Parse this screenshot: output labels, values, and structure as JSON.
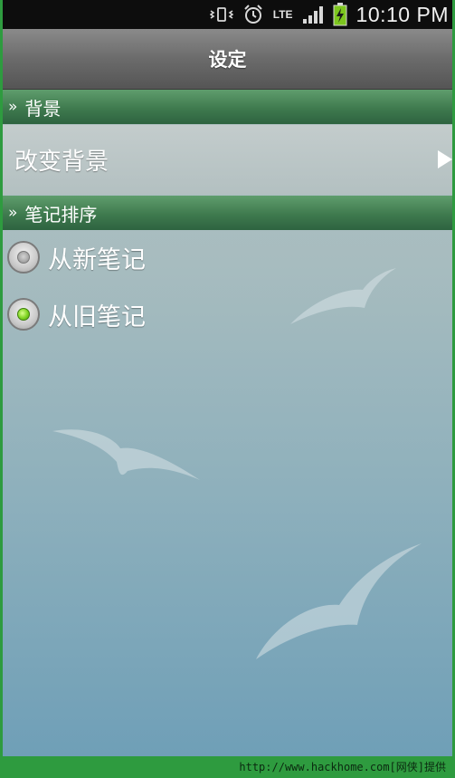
{
  "status_bar": {
    "icons": [
      "vibrate-icon",
      "alarm-icon",
      "lte-icon",
      "signal-icon",
      "battery-charging-icon"
    ],
    "lte_label": "LTE",
    "time": "10:10 PM"
  },
  "title_bar": {
    "title": "设定"
  },
  "sections": {
    "background": {
      "header": "背景",
      "change_background_label": "改变背景"
    },
    "sort": {
      "header": "笔记排序",
      "options": [
        {
          "label": "从新笔记",
          "selected": false
        },
        {
          "label": "从旧笔记",
          "selected": true
        }
      ]
    }
  },
  "header_prefix": "»",
  "colors": {
    "section_header_green": "#3f7a4e",
    "radio_selected": "#7ed321",
    "frame_green": "#2e9b3f"
  },
  "watermark": "http://www.hackhome.com[网侠]提供"
}
